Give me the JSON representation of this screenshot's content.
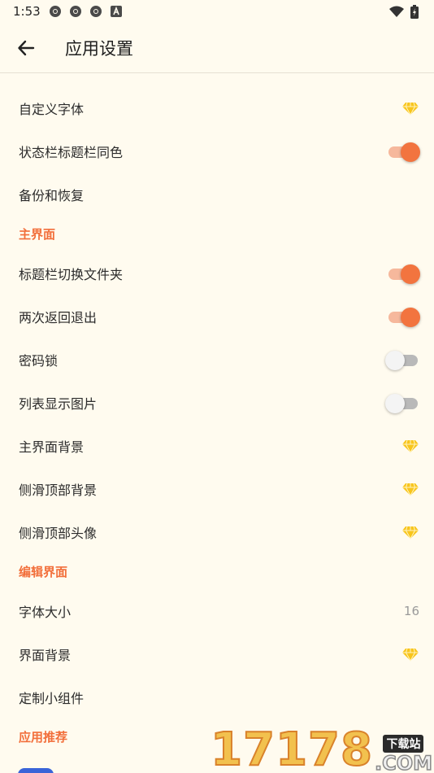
{
  "status_bar": {
    "time": "1:53",
    "left_icons": [
      "chrome-icon",
      "chrome-icon",
      "chrome-icon",
      "a-icon"
    ],
    "right_icons": [
      "wifi-icon",
      "battery-icon"
    ]
  },
  "app_bar": {
    "title": "应用设置",
    "back_icon": "arrow-left-icon"
  },
  "colors": {
    "background": "#fffbef",
    "accent": "#f2743f",
    "section_header": "#f26f3b",
    "premium_gem": "#f8c51c"
  },
  "settings": {
    "custom_font": {
      "label": "自定义字体",
      "premium": true
    },
    "status_bar_same_color": {
      "label": "状态栏标题栏同色",
      "toggle": true
    },
    "backup_restore": {
      "label": "备份和恢复"
    },
    "section_main": "主界面",
    "title_bar_switch_folder": {
      "label": "标题栏切换文件夹",
      "toggle": true
    },
    "double_back_exit": {
      "label": "两次返回退出",
      "toggle": true
    },
    "password_lock": {
      "label": "密码锁",
      "toggle": false
    },
    "list_show_images": {
      "label": "列表显示图片",
      "toggle": false
    },
    "main_background": {
      "label": "主界面背景",
      "premium": true
    },
    "drawer_top_background": {
      "label": "侧滑顶部背景",
      "premium": true
    },
    "drawer_top_avatar": {
      "label": "侧滑顶部头像",
      "premium": true
    },
    "section_edit": "编辑界面",
    "font_size": {
      "label": "字体大小",
      "value": "16"
    },
    "ui_background": {
      "label": "界面背景",
      "premium": true
    },
    "custom_widget": {
      "label": "定制小组件"
    },
    "section_recommend": "应用推荐"
  },
  "watermark": {
    "digits": "17178",
    "badge": "下载站",
    "suffix": ".COM"
  }
}
